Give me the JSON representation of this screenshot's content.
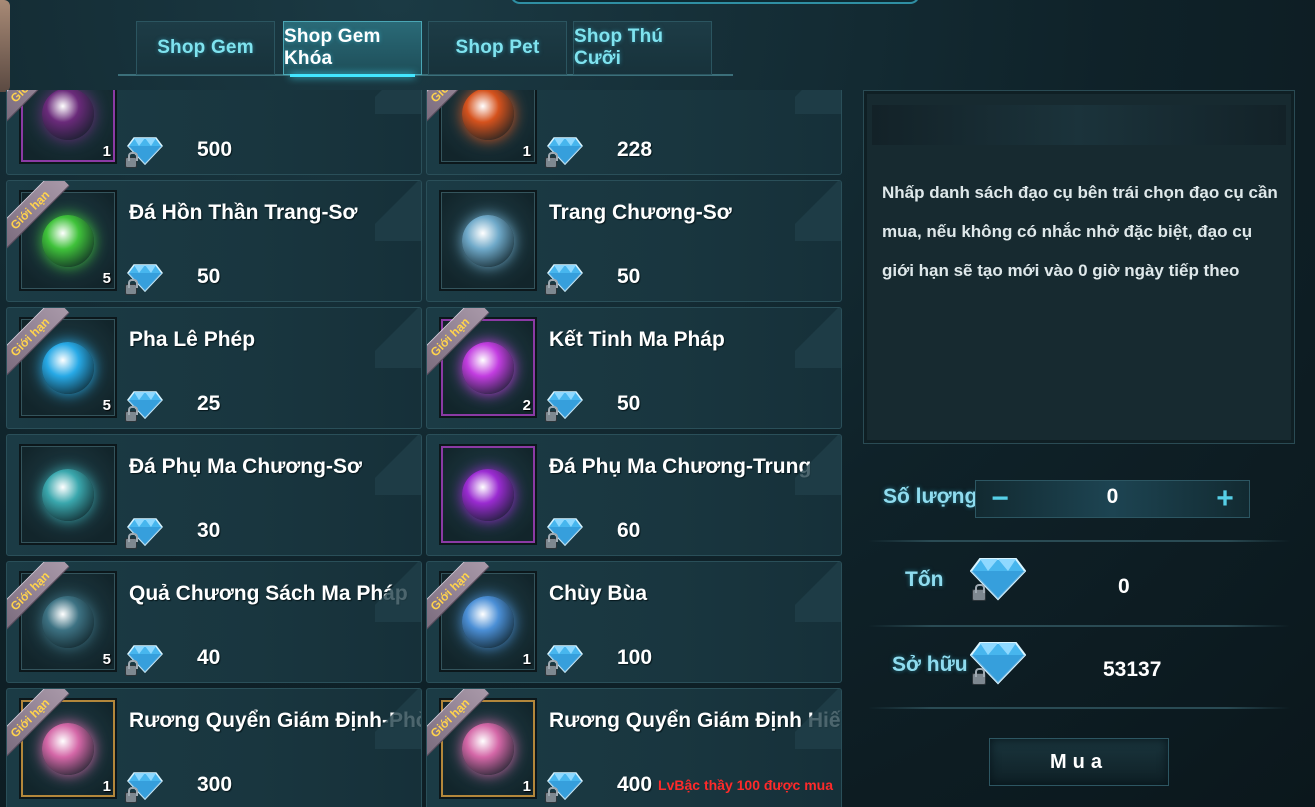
{
  "tabs": [
    {
      "label": "Shop Gem",
      "active": false
    },
    {
      "label": "Shop Gem Khóa",
      "active": true
    },
    {
      "label": "Shop Pet",
      "active": false
    },
    {
      "label": "Shop Thú Cưỡi",
      "active": false
    }
  ],
  "ribbon_text": "Giới hạn",
  "items": [
    {
      "name": "",
      "qty": "1",
      "price": "500",
      "limited": true,
      "icon": "dark-weapon-icon",
      "frame": "purple",
      "color": "#6a2a7a"
    },
    {
      "name": "",
      "qty": "1",
      "price": "228",
      "limited": true,
      "icon": "red-orb-icon",
      "frame": "normal",
      "color": "#d5521d"
    },
    {
      "name": "Đá Hồn Thần Trang-Sơ",
      "qty": "5",
      "price": "50",
      "limited": true,
      "icon": "green-soul-stone-icon",
      "frame": "normal",
      "color": "#3fc23a"
    },
    {
      "name": "Trang Chương-Sơ",
      "qty": "",
      "price": "50",
      "limited": false,
      "icon": "scroll-page-icon",
      "frame": "normal",
      "color": "#6fa9c9"
    },
    {
      "name": "Pha Lê Phép",
      "qty": "5",
      "price": "25",
      "limited": true,
      "icon": "blue-crystal-icon",
      "frame": "normal",
      "color": "#27a9e6"
    },
    {
      "name": "Kết Tinh Ma Pháp",
      "qty": "2",
      "price": "50",
      "limited": true,
      "icon": "purple-crystal-icon",
      "frame": "purple",
      "color": "#c23de0"
    },
    {
      "name": "Đá Phụ Ma Chương-Sơ",
      "qty": "",
      "price": "30",
      "limited": false,
      "icon": "teal-rune-stone-icon",
      "frame": "normal",
      "color": "#3aa7ad"
    },
    {
      "name": "Đá Phụ Ma Chương-Trung",
      "qty": "",
      "price": "60",
      "limited": false,
      "icon": "purple-rune-stone-icon",
      "frame": "purple",
      "color": "#9a2bd1"
    },
    {
      "name": "Quả Chương Sách Ma Pháp",
      "qty": "5",
      "price": "40",
      "limited": true,
      "icon": "mystery-question-icon",
      "frame": "normal",
      "color": "#3d7283"
    },
    {
      "name": "Chùy Bùa",
      "qty": "1",
      "price": "100",
      "limited": true,
      "icon": "blue-mace-icon",
      "frame": "normal",
      "color": "#4b8fd6"
    },
    {
      "name": "Rương Quyển Giám Định-Phòng Cụ",
      "qty": "1",
      "price": "300",
      "limited": true,
      "icon": "gift-chest-icon",
      "frame": "gold",
      "color": "#d467a7"
    },
    {
      "name": "Rương Quyển Giám Định Hiếm-Phòng",
      "qty": "1",
      "price": "400",
      "limited": true,
      "icon": "gift-chest-icon",
      "frame": "gold",
      "color": "#d467a7",
      "requirement": "LvBậc thầy 100 được mua"
    }
  ],
  "info": {
    "description": "Nhấp danh sách đạo cụ bên trái chọn đạo cụ cần mua, nếu không có nhắc nhở đặc biệt, đạo cụ giới hạn sẽ tạo mới vào 0 giờ ngày tiếp theo"
  },
  "purchase": {
    "quantity_label": "Số lượng",
    "quantity_value": "0",
    "minus": "−",
    "plus": "+",
    "cost_label": "Tốn",
    "cost_value": "0",
    "owned_label": "Sở hữu",
    "owned_value": "53137",
    "buy_label": "Mua"
  },
  "colors": {
    "accent": "#43e6ff",
    "tab_text": "#7fe3ef",
    "requirement": "#ff2a2a",
    "ribbon_text": "#ffd34c"
  }
}
